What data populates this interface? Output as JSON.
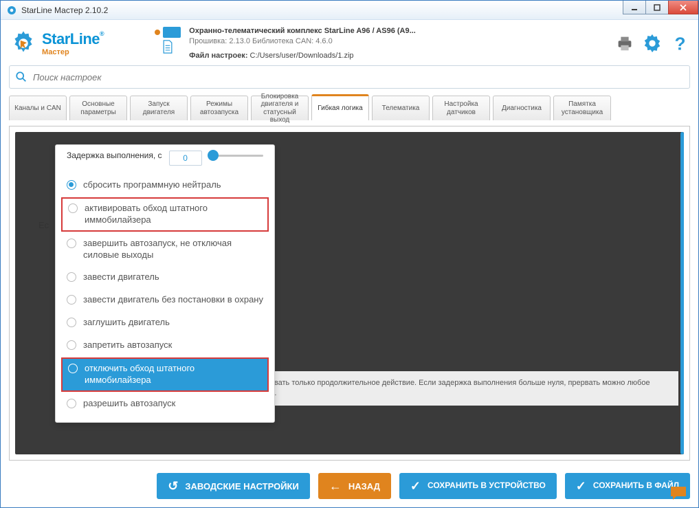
{
  "window": {
    "title": "StarLine Мастер 2.10.2"
  },
  "logo": {
    "brand": "StarLine",
    "sub": "Мастер"
  },
  "device": {
    "name": "Охранно-телематический комплекс StarLine A96 / AS96 (A9...",
    "firmware": "Прошивка: 2.13.0    Библиотека CAN: 4.6.0",
    "file_label": "Файл настроек:",
    "file_path": "C:/Users/user/Downloads/1.zip"
  },
  "search": {
    "placeholder": "Поиск настроек"
  },
  "tabs": [
    "Каналы и CAN",
    "Основные параметры",
    "Запуск двигателя",
    "Режимы автозапуска",
    "Блокировка двигателя и статусный выход",
    "Гибкая логика",
    "Телематика",
    "Настройка датчиков",
    "Диагностика",
    "Памятка установщика"
  ],
  "popup": {
    "delay_label": "Задержка выполнения, с",
    "delay_value": "0",
    "options": [
      {
        "label": "сбросить программную нейтраль",
        "selected": true
      },
      {
        "label": "активировать обход штатного иммобилайзера",
        "boxed": true
      },
      {
        "label": "завершить автозапуск, не отключая силовые выходы"
      },
      {
        "label": "завести двигатель"
      },
      {
        "label": "завести двигатель без постановки в охрану"
      },
      {
        "label": "заглушить двигатель"
      },
      {
        "label": "запретить автозапуск"
      },
      {
        "label": "отключить обход штатного иммобилайзера",
        "highlight": true,
        "boxed": true
      },
      {
        "label": "разрешить автозапуск"
      }
    ]
  },
  "info_strip": "жно прервать только продолжительное действие. Если задержка выполнения больше нуля, прервать можно любое действие.",
  "cut_label": "Ес",
  "buttons": {
    "factory": "ЗАВОДСКИЕ НАСТРОЙКИ",
    "back": "НАЗАД",
    "save_device": "СОХРАНИТЬ В УСТРОЙСТВО",
    "save_file": "СОХРАНИТЬ В ФАЙЛ"
  }
}
